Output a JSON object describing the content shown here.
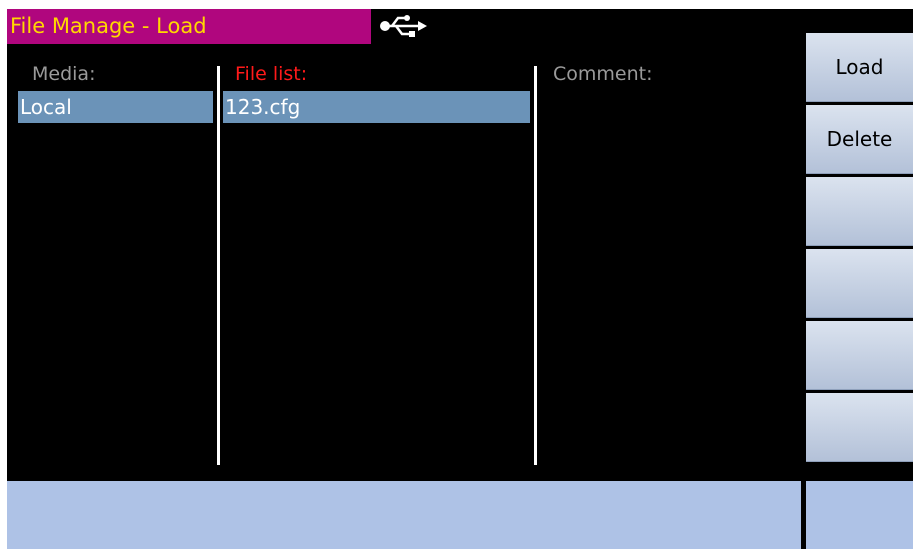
{
  "title_bar": {
    "title": "File Manage - Load",
    "usb_icon": "usb-icon"
  },
  "columns": {
    "media_header": "Media:",
    "files_header": "File list:",
    "comment_header": "Comment:"
  },
  "media": {
    "items": [
      {
        "label": "Local",
        "selected": true
      }
    ]
  },
  "files": {
    "items": [
      {
        "name": "123.cfg",
        "selected": true
      }
    ]
  },
  "softkeys": [
    {
      "label": "Load"
    },
    {
      "label": "Delete"
    },
    {
      "label": ""
    },
    {
      "label": ""
    },
    {
      "label": ""
    },
    {
      "label": ""
    }
  ],
  "colors": {
    "title_bg": "#b0067e",
    "title_text": "#ffd800",
    "selection": "#6b93b8",
    "active_header": "#ff1a1a",
    "status_bar": "#aec2e6"
  }
}
